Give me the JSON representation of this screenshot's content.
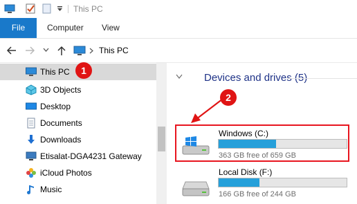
{
  "window": {
    "title": "This PC"
  },
  "ribbon": {
    "tabs": [
      "File",
      "Computer",
      "View"
    ]
  },
  "address": {
    "path_label": "This PC"
  },
  "nav": {
    "items": [
      {
        "label": "This PC",
        "icon": "computer-icon",
        "selected": true
      },
      {
        "label": "3D Objects",
        "icon": "cube-icon"
      },
      {
        "label": "Desktop",
        "icon": "desktop-icon"
      },
      {
        "label": "Documents",
        "icon": "documents-icon"
      },
      {
        "label": "Downloads",
        "icon": "download-icon"
      },
      {
        "label": "Etisalat-DGA4231 Gateway",
        "icon": "network-icon"
      },
      {
        "label": "iCloud Photos",
        "icon": "photos-icon"
      },
      {
        "label": "Music",
        "icon": "music-icon"
      }
    ]
  },
  "content": {
    "section_title": "Devices and drives (5)",
    "drives": [
      {
        "name": "Windows (C:)",
        "free_text": "363 GB free of 659 GB",
        "used_fraction": 0.45,
        "icon": "windows-drive-icon"
      },
      {
        "name": "Local Disk (F:)",
        "free_text": "166 GB free of 244 GB",
        "used_fraction": 0.32,
        "icon": "hard-drive-icon"
      }
    ]
  },
  "annotations": {
    "marker1": "1",
    "marker2": "2"
  },
  "colors": {
    "accent": "#1979ca",
    "bar_fill": "#26a0da",
    "marker": "#e01414",
    "section_title": "#1e3287"
  }
}
